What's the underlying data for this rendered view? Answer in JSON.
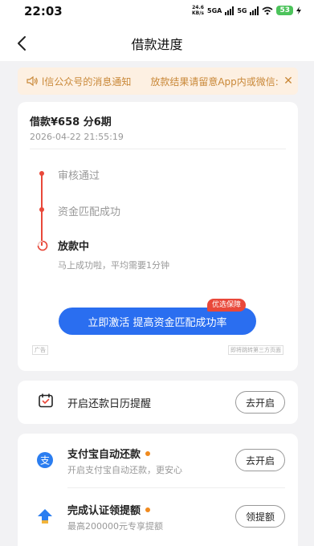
{
  "status_bar": {
    "time": "22:03",
    "net_speed_value": "24.6",
    "net_speed_unit": "KB/s",
    "network_label": "5GA",
    "network_label2": "5G",
    "battery": "53"
  },
  "nav": {
    "title": "借款进度"
  },
  "notice": {
    "text": "l信公众号的消息通知　　放款结果请留意App内或微信:",
    "close": "✕"
  },
  "loan": {
    "amount_label": "借款¥658 分6期",
    "datetime": "2026-04-22 21:55:19"
  },
  "timeline": {
    "steps": [
      "审核通过",
      "资金匹配成功"
    ],
    "current": "放款中",
    "current_sub": "马上成功啦，平均需要1分钟"
  },
  "promo": {
    "badge": "优选保障",
    "button": "立即激活 提高资金匹配成功率",
    "ad_tag": "广告",
    "ad_note": "即将跳转第三方页面"
  },
  "calendar": {
    "label": "开启还款日历提醒",
    "button": "去开启"
  },
  "items": [
    {
      "title": "支付宝自动还款",
      "sub": "开启支付宝自动还款，更安心",
      "button": "去开启"
    },
    {
      "title": "完成认证领提额",
      "sub": "最高200000元专享提额",
      "button": "领提额"
    }
  ],
  "colors": {
    "accent_blue": "#2a6ef0",
    "accent_red": "#e9483a",
    "notice_bg": "#fdf0e2",
    "notice_text": "#c98838",
    "dot_orange": "#f08a1e"
  }
}
